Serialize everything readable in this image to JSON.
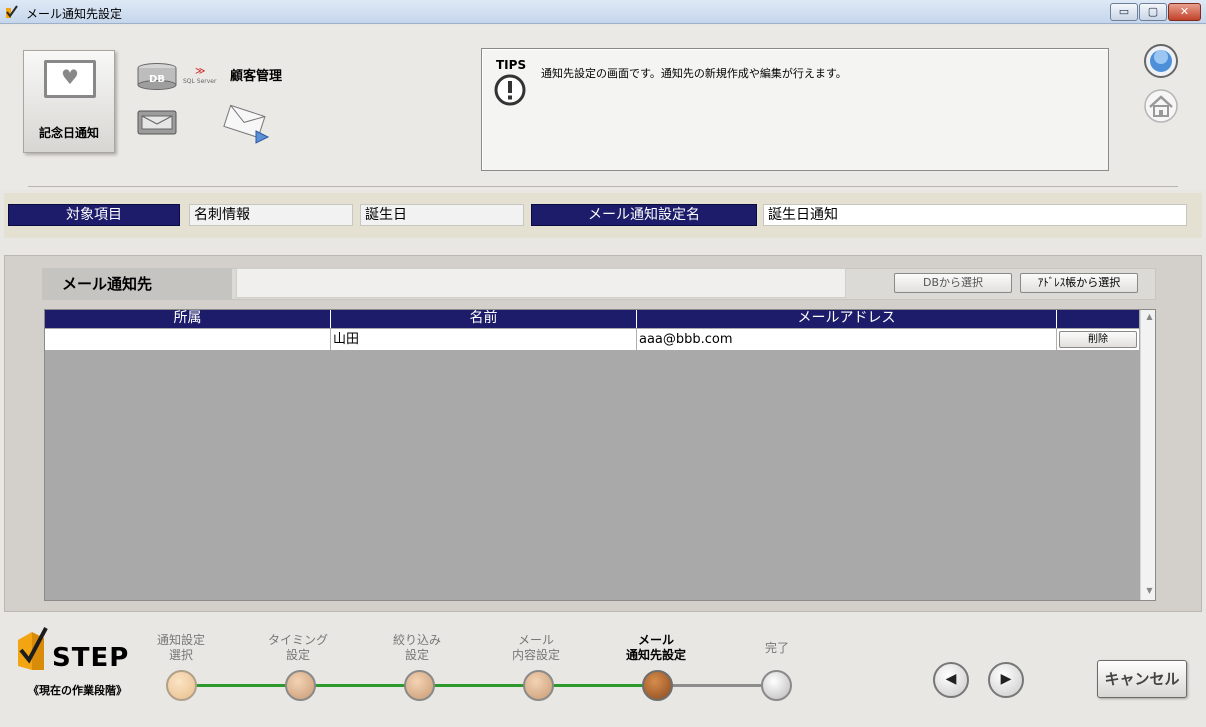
{
  "window": {
    "title": "メール通知先設定",
    "min_glyph": "▭",
    "max_glyph": "▢",
    "close_glyph": "✕"
  },
  "header": {
    "anniversary_label": "記念日通知",
    "anniversary_icon": "heart-monitor-icon",
    "db_icon_text": "DB",
    "sql_text": "SQL Server",
    "customer_label": "顧客管理",
    "tips": {
      "label": "TIPS",
      "text": "通知先設定の画面です。通知先の新規作成や編集が行えます。"
    }
  },
  "target": {
    "label": "対象項目",
    "value_1": "名刺情報",
    "value_2": "誕生日",
    "mail_setting_label": "メール通知設定名",
    "mail_setting_value": "誕生日通知"
  },
  "recipients": {
    "label": "メール通知先",
    "db_select": "DBから選択",
    "address_select": "ｱﾄﾞﾚｽ帳から選択",
    "columns": {
      "dept": "所属",
      "name": "名前",
      "email": "メールアドレス"
    },
    "rows": [
      {
        "dept": "",
        "name": "山田",
        "email": "aaa@bbb.com",
        "action": "削除"
      }
    ]
  },
  "footer": {
    "step_title": "STEP",
    "step_subtitle": "《現在の作業段階》",
    "steps": [
      {
        "label": "通知設定\n選択",
        "state": "done"
      },
      {
        "label": "タイミング\n設定",
        "state": "done"
      },
      {
        "label": "絞り込み\n設定",
        "state": "done"
      },
      {
        "label": "メール\n内容設定",
        "state": "done"
      },
      {
        "label": "メール\n通知先設定",
        "state": "current"
      },
      {
        "label": "完了",
        "state": "pending"
      }
    ],
    "prev_glyph": "◀",
    "next_glyph": "▶",
    "cancel": "キャンセル"
  },
  "colors": {
    "navy": "#1c1c6b",
    "progress_green": "#2e9a2e",
    "current_step": "#8a4a1e"
  }
}
